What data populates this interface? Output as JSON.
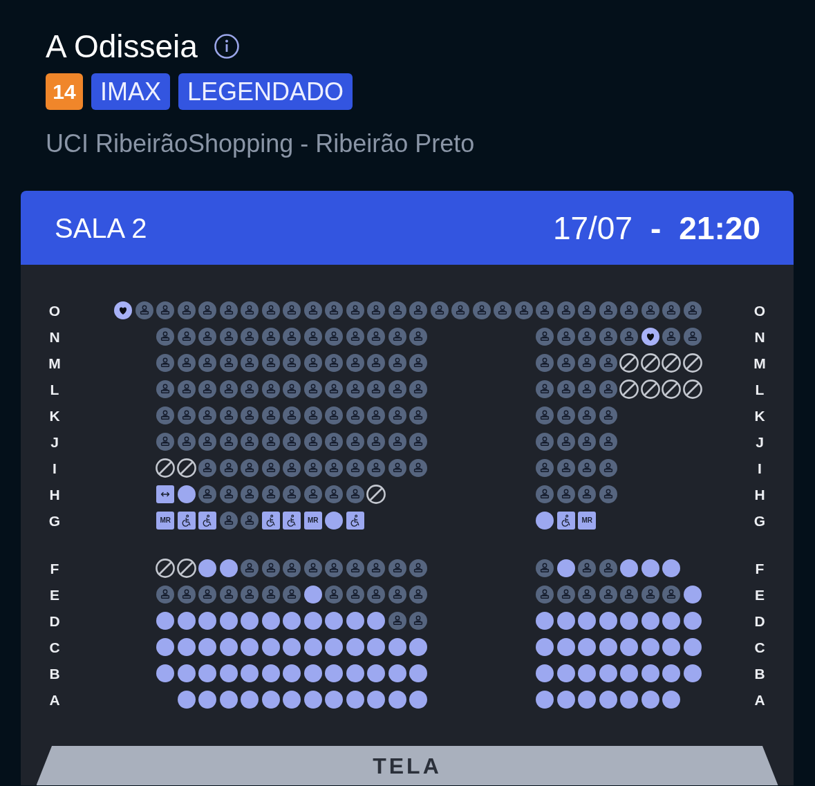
{
  "movie": {
    "title": "A Odisseia",
    "rating": "14",
    "tags": [
      "IMAX",
      "LEGENDADO"
    ],
    "cinema": "UCI RibeirãoShopping - Ribeirão Preto"
  },
  "session": {
    "room": "SALA 2",
    "date": "17/07",
    "separator": "-",
    "time": "21:20"
  },
  "seat_map": {
    "sections": [
      {
        "rows": [
          {
            "label_left": "O",
            "label_right": "O",
            "blocks": [
              {
                "kind": "full",
                "seats": [
                  {
                    "kind": "heart"
                  },
                  {
                    "kind": "taken"
                  },
                  {
                    "kind": "taken"
                  },
                  {
                    "kind": "taken"
                  },
                  {
                    "kind": "taken"
                  },
                  {
                    "kind": "taken"
                  },
                  {
                    "kind": "taken"
                  },
                  {
                    "kind": "taken"
                  },
                  {
                    "kind": "taken"
                  },
                  {
                    "kind": "taken"
                  },
                  {
                    "kind": "taken"
                  },
                  {
                    "kind": "taken"
                  },
                  {
                    "kind": "taken"
                  },
                  {
                    "kind": "taken"
                  },
                  {
                    "kind": "taken"
                  },
                  {
                    "kind": "taken"
                  },
                  {
                    "kind": "taken"
                  },
                  {
                    "kind": "taken"
                  },
                  {
                    "kind": "taken"
                  },
                  {
                    "kind": "taken"
                  },
                  {
                    "kind": "taken"
                  },
                  {
                    "kind": "taken"
                  },
                  {
                    "kind": "taken"
                  },
                  {
                    "kind": "taken"
                  },
                  {
                    "kind": "taken"
                  },
                  {
                    "kind": "taken"
                  },
                  {
                    "kind": "taken"
                  },
                  {
                    "kind": "taken"
                  }
                ]
              }
            ]
          },
          {
            "label_left": "N",
            "label_right": "N",
            "blocks": [
              {
                "kind": "left",
                "seats": [
                  {
                    "kind": "taken"
                  },
                  {
                    "kind": "taken"
                  },
                  {
                    "kind": "taken"
                  },
                  {
                    "kind": "taken"
                  },
                  {
                    "kind": "taken"
                  },
                  {
                    "kind": "taken"
                  },
                  {
                    "kind": "taken"
                  },
                  {
                    "kind": "taken"
                  },
                  {
                    "kind": "taken"
                  },
                  {
                    "kind": "taken"
                  },
                  {
                    "kind": "taken"
                  },
                  {
                    "kind": "taken"
                  },
                  {
                    "kind": "taken"
                  }
                ]
              },
              {
                "kind": "right",
                "seats": [
                  {
                    "kind": "taken"
                  },
                  {
                    "kind": "taken"
                  },
                  {
                    "kind": "taken"
                  },
                  {
                    "kind": "taken"
                  },
                  {
                    "kind": "taken"
                  },
                  {
                    "kind": "heart"
                  },
                  {
                    "kind": "taken"
                  },
                  {
                    "kind": "taken"
                  }
                ]
              }
            ]
          },
          {
            "label_left": "M",
            "label_right": "M",
            "blocks": [
              {
                "kind": "left",
                "seats": [
                  {
                    "kind": "taken"
                  },
                  {
                    "kind": "taken"
                  },
                  {
                    "kind": "taken"
                  },
                  {
                    "kind": "taken"
                  },
                  {
                    "kind": "taken"
                  },
                  {
                    "kind": "taken"
                  },
                  {
                    "kind": "taken"
                  },
                  {
                    "kind": "taken"
                  },
                  {
                    "kind": "taken"
                  },
                  {
                    "kind": "taken"
                  },
                  {
                    "kind": "taken"
                  },
                  {
                    "kind": "taken"
                  },
                  {
                    "kind": "taken"
                  }
                ]
              },
              {
                "kind": "right",
                "seats": [
                  {
                    "kind": "taken"
                  },
                  {
                    "kind": "taken"
                  },
                  {
                    "kind": "taken"
                  },
                  {
                    "kind": "taken"
                  },
                  {
                    "kind": "blocked"
                  },
                  {
                    "kind": "blocked"
                  },
                  {
                    "kind": "blocked"
                  },
                  {
                    "kind": "blocked"
                  }
                ]
              }
            ]
          },
          {
            "label_left": "L",
            "label_right": "L",
            "blocks": [
              {
                "kind": "left",
                "seats": [
                  {
                    "kind": "taken"
                  },
                  {
                    "kind": "taken"
                  },
                  {
                    "kind": "taken"
                  },
                  {
                    "kind": "taken"
                  },
                  {
                    "kind": "taken"
                  },
                  {
                    "kind": "taken"
                  },
                  {
                    "kind": "taken"
                  },
                  {
                    "kind": "taken"
                  },
                  {
                    "kind": "taken"
                  },
                  {
                    "kind": "taken"
                  },
                  {
                    "kind": "taken"
                  },
                  {
                    "kind": "taken"
                  },
                  {
                    "kind": "taken"
                  }
                ]
              },
              {
                "kind": "right",
                "seats": [
                  {
                    "kind": "taken"
                  },
                  {
                    "kind": "taken"
                  },
                  {
                    "kind": "taken"
                  },
                  {
                    "kind": "taken"
                  },
                  {
                    "kind": "blocked"
                  },
                  {
                    "kind": "blocked"
                  },
                  {
                    "kind": "blocked"
                  },
                  {
                    "kind": "blocked"
                  }
                ]
              }
            ]
          },
          {
            "label_left": "K",
            "label_right": "K",
            "blocks": [
              {
                "kind": "left",
                "seats": [
                  {
                    "kind": "taken"
                  },
                  {
                    "kind": "taken"
                  },
                  {
                    "kind": "taken"
                  },
                  {
                    "kind": "taken"
                  },
                  {
                    "kind": "taken"
                  },
                  {
                    "kind": "taken"
                  },
                  {
                    "kind": "taken"
                  },
                  {
                    "kind": "taken"
                  },
                  {
                    "kind": "taken"
                  },
                  {
                    "kind": "taken"
                  },
                  {
                    "kind": "taken"
                  },
                  {
                    "kind": "taken"
                  },
                  {
                    "kind": "taken"
                  }
                ]
              },
              {
                "kind": "right",
                "seats": [
                  {
                    "kind": "taken"
                  },
                  {
                    "kind": "taken"
                  },
                  {
                    "kind": "taken"
                  },
                  {
                    "kind": "taken"
                  }
                ]
              }
            ]
          },
          {
            "label_left": "J",
            "label_right": "J",
            "blocks": [
              {
                "kind": "left",
                "seats": [
                  {
                    "kind": "taken"
                  },
                  {
                    "kind": "taken"
                  },
                  {
                    "kind": "taken"
                  },
                  {
                    "kind": "taken"
                  },
                  {
                    "kind": "taken"
                  },
                  {
                    "kind": "taken"
                  },
                  {
                    "kind": "taken"
                  },
                  {
                    "kind": "taken"
                  },
                  {
                    "kind": "taken"
                  },
                  {
                    "kind": "taken"
                  },
                  {
                    "kind": "taken"
                  },
                  {
                    "kind": "taken"
                  },
                  {
                    "kind": "taken"
                  }
                ]
              },
              {
                "kind": "right",
                "seats": [
                  {
                    "kind": "taken"
                  },
                  {
                    "kind": "taken"
                  },
                  {
                    "kind": "taken"
                  },
                  {
                    "kind": "taken"
                  }
                ]
              }
            ]
          },
          {
            "label_left": "I",
            "label_right": "I",
            "blocks": [
              {
                "kind": "left",
                "seats": [
                  {
                    "kind": "blocked"
                  },
                  {
                    "kind": "blocked"
                  },
                  {
                    "kind": "taken"
                  },
                  {
                    "kind": "taken"
                  },
                  {
                    "kind": "taken"
                  },
                  {
                    "kind": "taken"
                  },
                  {
                    "kind": "taken"
                  },
                  {
                    "kind": "taken"
                  },
                  {
                    "kind": "taken"
                  },
                  {
                    "kind": "taken"
                  },
                  {
                    "kind": "taken"
                  },
                  {
                    "kind": "taken"
                  },
                  {
                    "kind": "taken"
                  }
                ]
              },
              {
                "kind": "right",
                "seats": [
                  {
                    "kind": "taken"
                  },
                  {
                    "kind": "taken"
                  },
                  {
                    "kind": "taken"
                  },
                  {
                    "kind": "taken"
                  }
                ]
              }
            ]
          },
          {
            "label_left": "H",
            "label_right": "H",
            "blocks": [
              {
                "kind": "left",
                "seats": [
                  {
                    "kind": "wide"
                  },
                  {
                    "kind": "free"
                  },
                  {
                    "kind": "taken"
                  },
                  {
                    "kind": "taken"
                  },
                  {
                    "kind": "taken"
                  },
                  {
                    "kind": "taken"
                  },
                  {
                    "kind": "taken"
                  },
                  {
                    "kind": "taken"
                  },
                  {
                    "kind": "taken"
                  },
                  {
                    "kind": "taken"
                  },
                  {
                    "kind": "blocked"
                  }
                ]
              },
              {
                "kind": "right",
                "seats": [
                  {
                    "kind": "taken"
                  },
                  {
                    "kind": "taken"
                  },
                  {
                    "kind": "taken"
                  },
                  {
                    "kind": "taken"
                  }
                ]
              }
            ]
          },
          {
            "label_left": "G",
            "label_right": "G",
            "blocks": [
              {
                "kind": "left",
                "seats": [
                  {
                    "kind": "mr",
                    "text": "MR"
                  },
                  {
                    "kind": "wheelchair"
                  },
                  {
                    "kind": "wheelchair"
                  },
                  {
                    "kind": "taken"
                  },
                  {
                    "kind": "taken"
                  },
                  {
                    "kind": "wheelchair"
                  },
                  {
                    "kind": "wheelchair"
                  },
                  {
                    "kind": "mr",
                    "text": "MR"
                  },
                  {
                    "kind": "free"
                  },
                  {
                    "kind": "wheelchair"
                  }
                ]
              },
              {
                "kind": "right",
                "seats": [
                  {
                    "kind": "free"
                  },
                  {
                    "kind": "wheelchair"
                  },
                  {
                    "kind": "mr",
                    "text": "MR"
                  }
                ]
              }
            ]
          }
        ]
      },
      {
        "rows": [
          {
            "label_left": "F",
            "label_right": "F",
            "blocks": [
              {
                "kind": "left",
                "seats": [
                  {
                    "kind": "blocked"
                  },
                  {
                    "kind": "blocked"
                  },
                  {
                    "kind": "free"
                  },
                  {
                    "kind": "free"
                  },
                  {
                    "kind": "taken"
                  },
                  {
                    "kind": "taken"
                  },
                  {
                    "kind": "taken"
                  },
                  {
                    "kind": "taken"
                  },
                  {
                    "kind": "taken"
                  },
                  {
                    "kind": "taken"
                  },
                  {
                    "kind": "taken"
                  },
                  {
                    "kind": "taken"
                  },
                  {
                    "kind": "taken"
                  }
                ]
              },
              {
                "kind": "right",
                "seats": [
                  {
                    "kind": "taken"
                  },
                  {
                    "kind": "free"
                  },
                  {
                    "kind": "taken"
                  },
                  {
                    "kind": "taken"
                  },
                  {
                    "kind": "free"
                  },
                  {
                    "kind": "free"
                  },
                  {
                    "kind": "free"
                  }
                ]
              }
            ]
          },
          {
            "label_left": "E",
            "label_right": "E",
            "blocks": [
              {
                "kind": "left",
                "seats": [
                  {
                    "kind": "taken"
                  },
                  {
                    "kind": "taken"
                  },
                  {
                    "kind": "taken"
                  },
                  {
                    "kind": "taken"
                  },
                  {
                    "kind": "taken"
                  },
                  {
                    "kind": "taken"
                  },
                  {
                    "kind": "taken"
                  },
                  {
                    "kind": "free"
                  },
                  {
                    "kind": "taken"
                  },
                  {
                    "kind": "taken"
                  },
                  {
                    "kind": "taken"
                  },
                  {
                    "kind": "taken"
                  },
                  {
                    "kind": "taken"
                  }
                ]
              },
              {
                "kind": "right",
                "seats": [
                  {
                    "kind": "taken"
                  },
                  {
                    "kind": "taken"
                  },
                  {
                    "kind": "taken"
                  },
                  {
                    "kind": "taken"
                  },
                  {
                    "kind": "taken"
                  },
                  {
                    "kind": "taken"
                  },
                  {
                    "kind": "taken"
                  },
                  {
                    "kind": "free"
                  }
                ]
              }
            ]
          },
          {
            "label_left": "D",
            "label_right": "D",
            "blocks": [
              {
                "kind": "left",
                "seats": [
                  {
                    "kind": "free"
                  },
                  {
                    "kind": "free"
                  },
                  {
                    "kind": "free"
                  },
                  {
                    "kind": "free"
                  },
                  {
                    "kind": "free"
                  },
                  {
                    "kind": "free"
                  },
                  {
                    "kind": "free"
                  },
                  {
                    "kind": "free"
                  },
                  {
                    "kind": "free"
                  },
                  {
                    "kind": "free"
                  },
                  {
                    "kind": "free"
                  },
                  {
                    "kind": "taken"
                  },
                  {
                    "kind": "taken"
                  }
                ]
              },
              {
                "kind": "right",
                "seats": [
                  {
                    "kind": "free"
                  },
                  {
                    "kind": "free"
                  },
                  {
                    "kind": "free"
                  },
                  {
                    "kind": "free"
                  },
                  {
                    "kind": "free"
                  },
                  {
                    "kind": "free"
                  },
                  {
                    "kind": "free"
                  },
                  {
                    "kind": "free"
                  }
                ]
              }
            ]
          },
          {
            "label_left": "C",
            "label_right": "C",
            "blocks": [
              {
                "kind": "left",
                "seats": [
                  {
                    "kind": "free"
                  },
                  {
                    "kind": "free"
                  },
                  {
                    "kind": "free"
                  },
                  {
                    "kind": "free"
                  },
                  {
                    "kind": "free"
                  },
                  {
                    "kind": "free"
                  },
                  {
                    "kind": "free"
                  },
                  {
                    "kind": "free"
                  },
                  {
                    "kind": "free"
                  },
                  {
                    "kind": "free"
                  },
                  {
                    "kind": "free"
                  },
                  {
                    "kind": "free"
                  },
                  {
                    "kind": "free"
                  }
                ]
              },
              {
                "kind": "right",
                "seats": [
                  {
                    "kind": "free"
                  },
                  {
                    "kind": "free"
                  },
                  {
                    "kind": "free"
                  },
                  {
                    "kind": "free"
                  },
                  {
                    "kind": "free"
                  },
                  {
                    "kind": "free"
                  },
                  {
                    "kind": "free"
                  },
                  {
                    "kind": "free"
                  }
                ]
              }
            ]
          },
          {
            "label_left": "B",
            "label_right": "B",
            "blocks": [
              {
                "kind": "left",
                "seats": [
                  {
                    "kind": "free"
                  },
                  {
                    "kind": "free"
                  },
                  {
                    "kind": "free"
                  },
                  {
                    "kind": "free"
                  },
                  {
                    "kind": "free"
                  },
                  {
                    "kind": "free"
                  },
                  {
                    "kind": "free"
                  },
                  {
                    "kind": "free"
                  },
                  {
                    "kind": "free"
                  },
                  {
                    "kind": "free"
                  },
                  {
                    "kind": "free"
                  },
                  {
                    "kind": "free"
                  },
                  {
                    "kind": "free"
                  }
                ]
              },
              {
                "kind": "right",
                "seats": [
                  {
                    "kind": "free"
                  },
                  {
                    "kind": "free"
                  },
                  {
                    "kind": "free"
                  },
                  {
                    "kind": "free"
                  },
                  {
                    "kind": "free"
                  },
                  {
                    "kind": "free"
                  },
                  {
                    "kind": "free"
                  },
                  {
                    "kind": "free"
                  }
                ]
              }
            ]
          },
          {
            "label_left": "A",
            "label_right": "A",
            "blocks": [
              {
                "kind": "inset",
                "seats": [
                  {
                    "kind": "free"
                  },
                  {
                    "kind": "free"
                  },
                  {
                    "kind": "free"
                  },
                  {
                    "kind": "free"
                  },
                  {
                    "kind": "free"
                  },
                  {
                    "kind": "free"
                  },
                  {
                    "kind": "free"
                  },
                  {
                    "kind": "free"
                  },
                  {
                    "kind": "free"
                  },
                  {
                    "kind": "free"
                  },
                  {
                    "kind": "free"
                  },
                  {
                    "kind": "free"
                  }
                ]
              },
              {
                "kind": "right",
                "seats": [
                  {
                    "kind": "free"
                  },
                  {
                    "kind": "free"
                  },
                  {
                    "kind": "free"
                  },
                  {
                    "kind": "free"
                  },
                  {
                    "kind": "free"
                  },
                  {
                    "kind": "free"
                  },
                  {
                    "kind": "free"
                  }
                ]
              }
            ]
          }
        ]
      }
    ],
    "screen": "TELA"
  }
}
